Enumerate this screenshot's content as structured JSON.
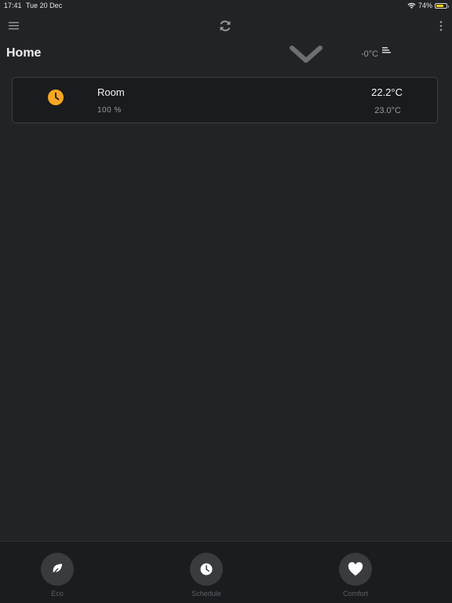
{
  "status_bar": {
    "time": "17:41",
    "date": "Tue 20 Dec",
    "battery": "74%",
    "battery_level": 0.74,
    "battery_color": "#f5d10a"
  },
  "nav": {
    "icons": [
      "menu-icon",
      "refresh-icon",
      "more-icon"
    ]
  },
  "header": {
    "title": "Home",
    "outside_temp": "-0°C"
  },
  "rooms": [
    {
      "name": "Room",
      "valve": "100 %",
      "current_temp": "22.2°C",
      "target_temp": "23.0°C",
      "mode_icon": "clock-icon",
      "mode_color": "#f5a623"
    }
  ],
  "modes": [
    {
      "label": "Eco",
      "icon": "leaf-icon"
    },
    {
      "label": "Schedule",
      "icon": "clock-icon"
    },
    {
      "label": "Comfort",
      "icon": "heart-icon"
    }
  ],
  "colors": {
    "background": "#222326",
    "card": "#1a1b1e",
    "accent": "#f5a623"
  }
}
